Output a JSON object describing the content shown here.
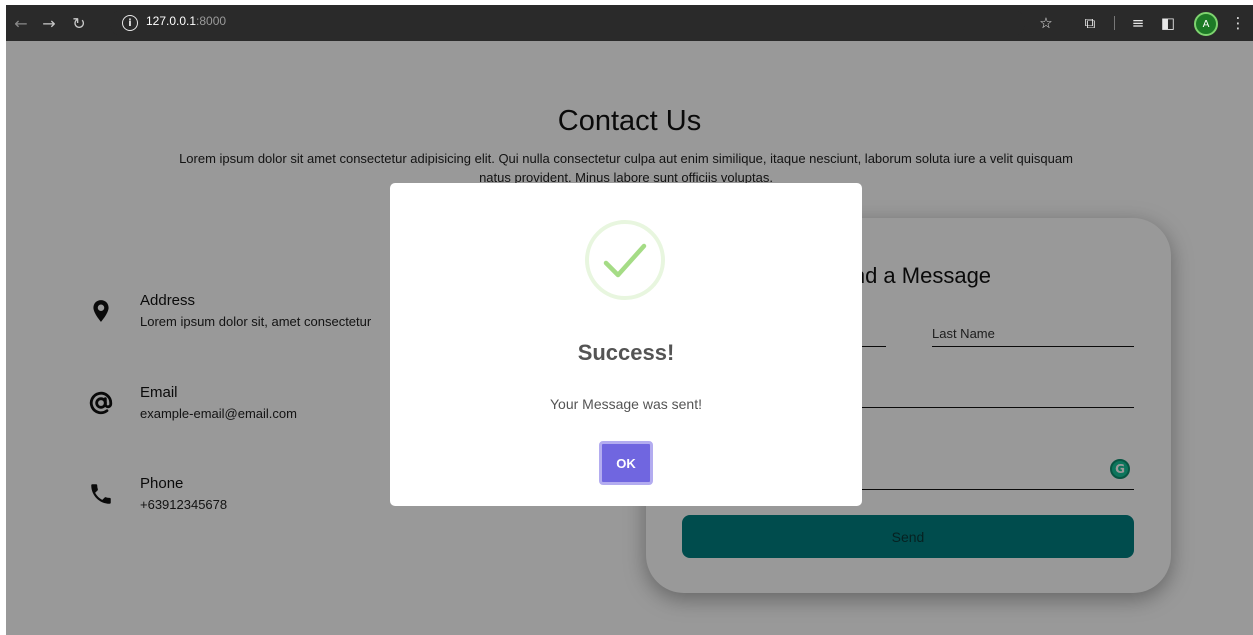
{
  "browser": {
    "url_host": "127.0.0.1",
    "url_port": ":8000",
    "avatar_letter": "A"
  },
  "page": {
    "title": "Contact Us",
    "subtitle": "Lorem ipsum dolor sit amet consectetur adipisicing elit. Qui nulla consectetur culpa aut enim similique, itaque nesciunt, laborum soluta iure a velit quisquam natus provident. Minus labore sunt officiis voluptas.",
    "contacts": [
      {
        "label": "Address",
        "value": "Lorem ipsum dolor sit, amet consectetur",
        "icon": "map-pin-icon"
      },
      {
        "label": "Email",
        "value": "example-email@email.com",
        "icon": "at-sign-icon"
      },
      {
        "label": "Phone",
        "value": "+63912345678",
        "icon": "phone-icon"
      }
    ],
    "form": {
      "title": "Send a Message",
      "last_name_label": "Last Name",
      "send_label": "Send"
    }
  },
  "modal": {
    "title": "Success!",
    "text": "Your Message was sent!",
    "ok_label": "OK"
  },
  "colors": {
    "accent": "#007f80",
    "confirm": "#7066e0",
    "success": "#a5dc86"
  }
}
